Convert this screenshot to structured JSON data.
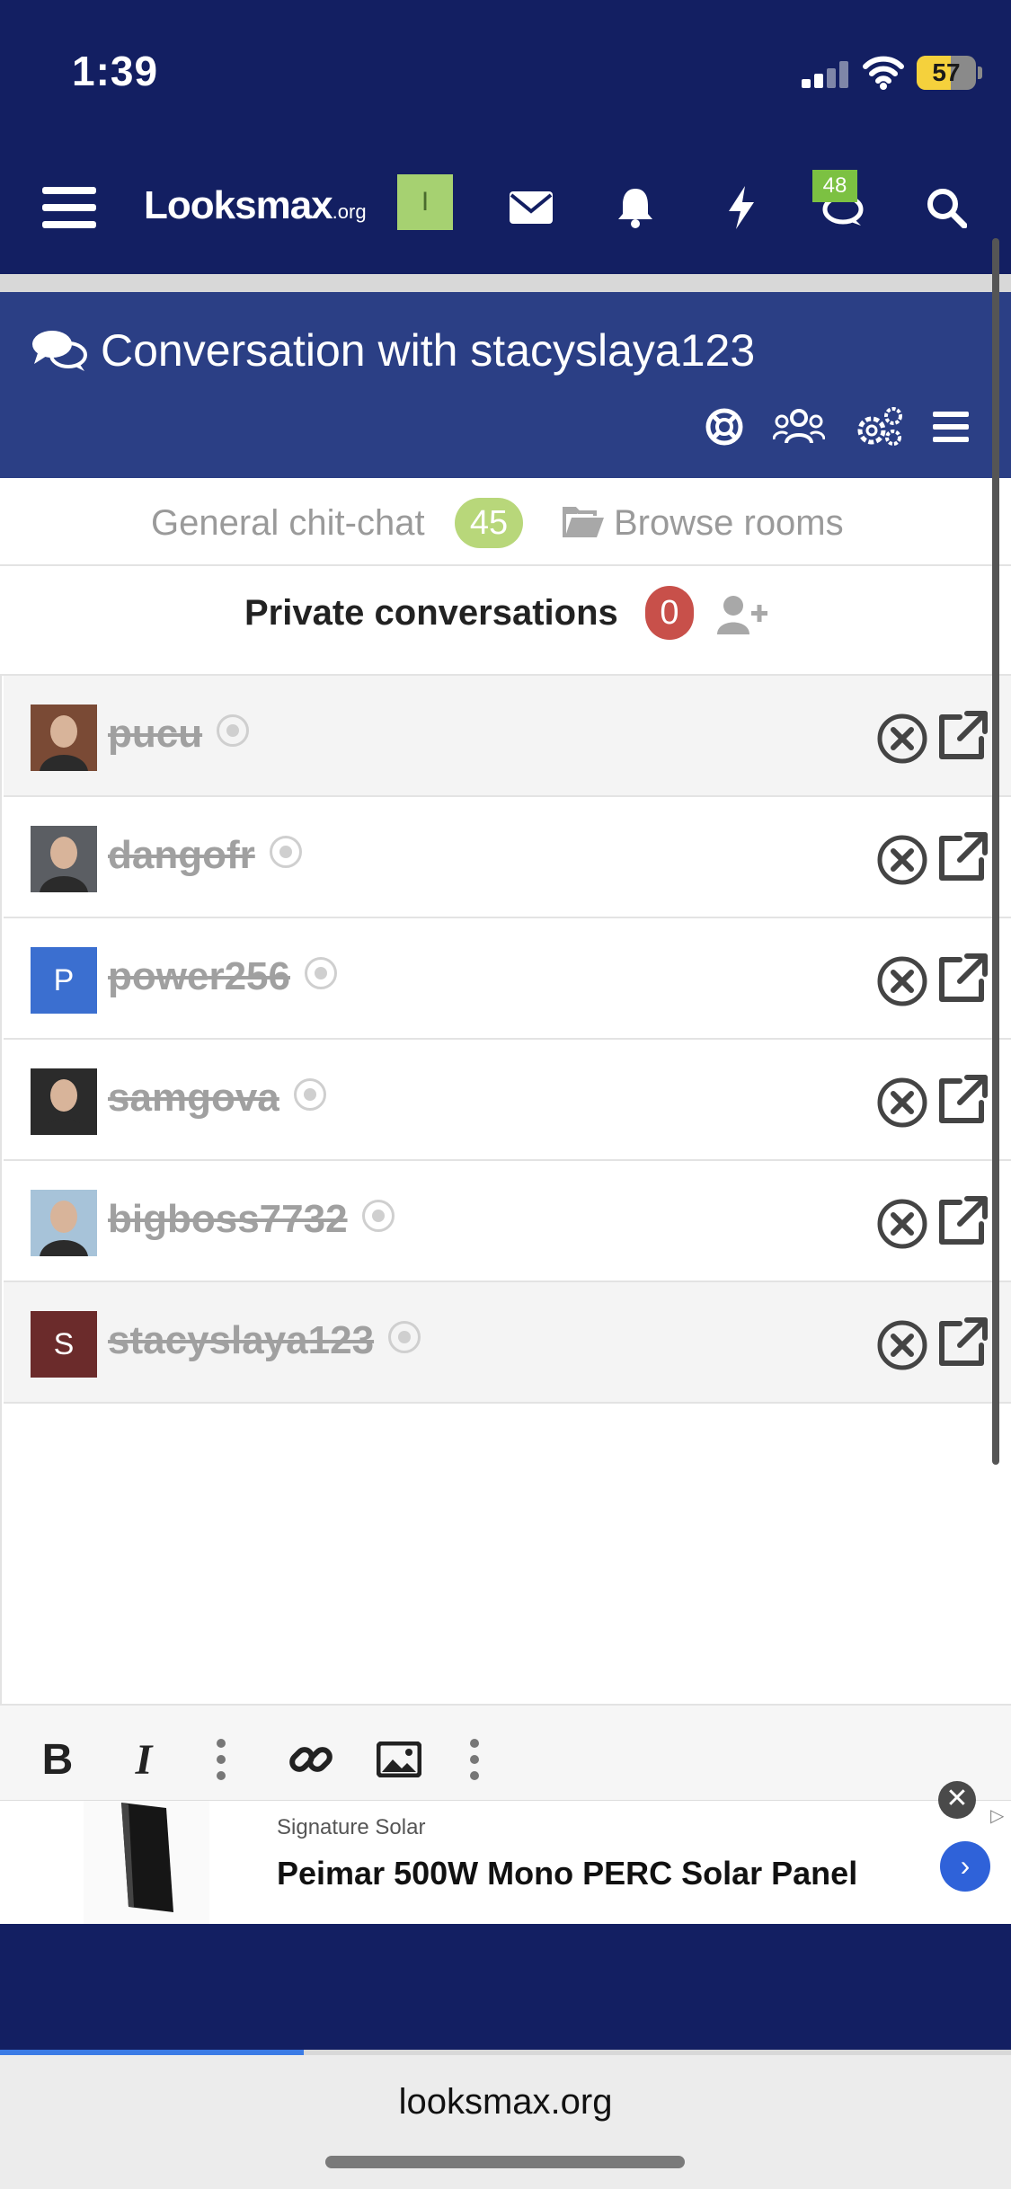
{
  "status_bar": {
    "time": "1:39",
    "battery": "57",
    "battery_level": 0.57
  },
  "top_nav": {
    "logo_main": "Looksmax",
    "logo_suffix": ".org",
    "user_initial": "I",
    "chat_badge": "48",
    "icons": [
      "menu-icon",
      "envelope-icon",
      "bell-icon",
      "lightning-icon",
      "chat-icon",
      "search-icon"
    ]
  },
  "conversation": {
    "title": "Conversation with stacyslaya123",
    "header_icons": [
      "lifebuoy-icon",
      "users-icon",
      "settings-icon",
      "menu-icon"
    ]
  },
  "tabs": {
    "general_label": "General chit-chat",
    "general_count": "45",
    "browse_label": "Browse rooms"
  },
  "private": {
    "label": "Private conversations",
    "count": "0"
  },
  "conversations": [
    {
      "name": "pucu",
      "avatar": "image",
      "avatar_color": "#7a4a35"
    },
    {
      "name": "dangofr",
      "avatar": "image",
      "avatar_color": "#5b5e63"
    },
    {
      "name": "power256",
      "avatar": "P",
      "avatar_color": "#3b6fd0"
    },
    {
      "name": "samgova",
      "avatar": "image",
      "avatar_color": "#2b2b2b"
    },
    {
      "name": "bigboss7732",
      "avatar": "image",
      "avatar_color": "#a7c3d9"
    },
    {
      "name": "stacyslaya123",
      "avatar": "S",
      "avatar_color": "#6b2b2b"
    }
  ],
  "editor": {
    "bold": "B",
    "italic": "I"
  },
  "ad": {
    "brand": "Signature Solar",
    "title": "Peimar 500W Mono PERC Solar Panel",
    "close": "✕",
    "go": "›",
    "choice": "▷"
  },
  "browser": {
    "url": "looksmax.org",
    "load_progress": 0.3
  }
}
